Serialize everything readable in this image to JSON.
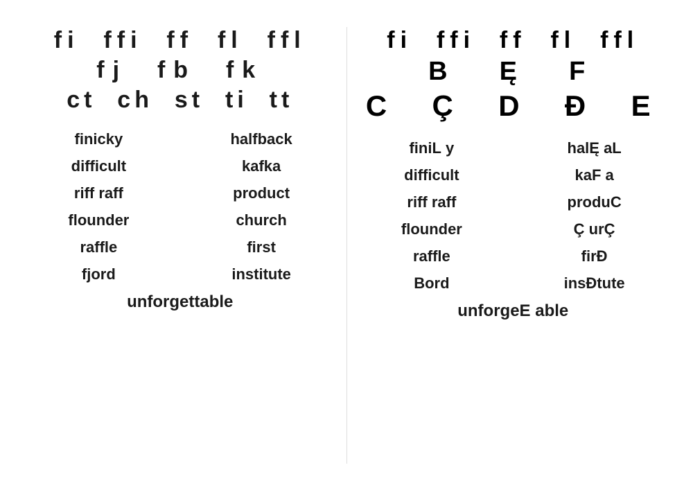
{
  "left_column": {
    "header_rows": [
      "fi  ffi  ff  fl  ffl",
      "fj  fb  fk",
      "ct  ch  st  ti  tt"
    ],
    "words": [
      [
        "finicky",
        "halfback"
      ],
      [
        "difficult",
        "kafka"
      ],
      [
        "riff raff",
        "product"
      ],
      [
        "flounder",
        "church"
      ],
      [
        "raffle",
        "first"
      ],
      [
        "fjord",
        "institute"
      ]
    ],
    "bottom": "unforgettable"
  },
  "right_column": {
    "header_rows": [
      "fi  ffi  ff  fl  ffl",
      "B  Ę  F",
      "C  Ç  D  Đ  E"
    ],
    "words": [
      [
        "finiL  y",
        "halĘ aL"
      ],
      [
        "difficult",
        "kaF a"
      ],
      [
        "riff raff",
        "produC"
      ],
      [
        "flounder",
        "Ç urÇ"
      ],
      [
        "raffle",
        "firĐ"
      ],
      [
        "Bord",
        "insĐtute"
      ]
    ],
    "bottom": "unforgeE able"
  }
}
